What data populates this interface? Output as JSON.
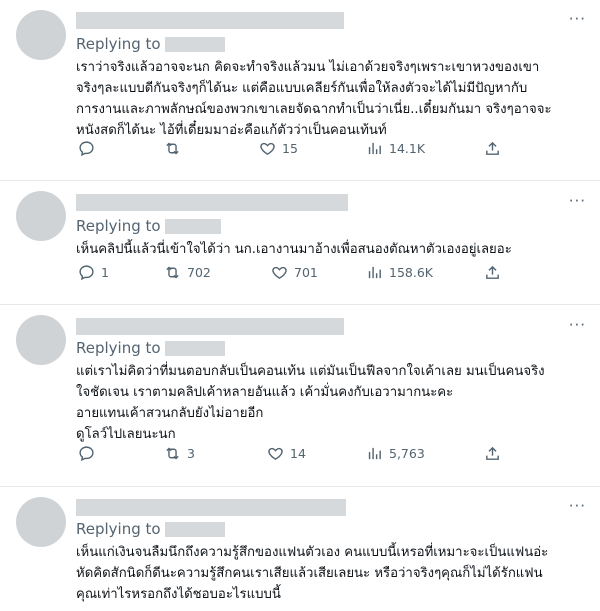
{
  "tweets": [
    {
      "replying_label": "Replying to",
      "text": "เราว่าจริงแล้วอาจจะนก คิดจะทำจริงแล้วมน ไม่เอาด้วยจริงๆเพราะเขาหวงของเขา\nจริงๆละแบบดีกันจริงๆก็ได้นะ แต่คือแบบเคลียร์กันเพื่อให้ลงตัวจะได้ไม่มีปัญหากับ\nการงานและภาพลักษณ์ของพวกเขาเลยจัดฉากทำเป็นว่าเนี่ย..เดี๋ยมกันมา จริงๆอาจจะ\nหนังสดก็ได้นะ ไอ้ที่เดี๋ยมมาอ่ะคือแก้ตัวว่าเป็นคอนเท้นท์",
      "reply_count": "",
      "retweet_count": "",
      "like_count": "15",
      "view_count": "14.1K"
    },
    {
      "replying_label": "Replying to",
      "text": "เห็นคลิปนี้แล้วนี่เข้าใจได้ว่า นก.เอางานมาอ้างเพื่อสนองตัณหาตัวเองอยู่เลยอะ",
      "reply_count": "1",
      "retweet_count": "702",
      "like_count": "701",
      "view_count": "158.6K"
    },
    {
      "replying_label": "Replying to",
      "text": "แต่เราไม่คิดว่าที่มนตอบกลับเป็นคอนเท้น แต่มันเป็นฟีลจากใจเค้าเลย มนเป็นคนจริง\nใจชัดเจน เราตามคลิปเค้าหลายอันแล้ว เค้ามั่นคงกับเอวามากนะคะ\nอายแทนเค้าสวนกลับยังไม่อายอีก\nดูโลว์ไปเลยนะนก",
      "reply_count": "",
      "retweet_count": "3",
      "like_count": "14",
      "view_count": "5,763"
    },
    {
      "replying_label": "Replying to",
      "text": "เห็นแก่เงินจนลืมนึกถึงความรู้สึกของแฟนตัวเอง คนแบบนี้เหรอที่เหมาะจะเป็นแฟนอ่ะ\nหัดคิดสักนิดก็ดีนะความรู้สึกคนเราเสียแล้วเสียเลยนะ หรือว่าจริงๆคุณก็ไม่ได้รักแฟน\nคุณเท่าไรหรอกถึงได้ชอบอะไรแบบนี้"
    }
  ],
  "icons": {
    "reply": "reply-bubble-icon",
    "retweet": "retweet-icon",
    "like": "heart-icon",
    "views": "views-chart-icon",
    "share": "share-icon",
    "more": "more-dots-icon"
  },
  "more_label": "···"
}
